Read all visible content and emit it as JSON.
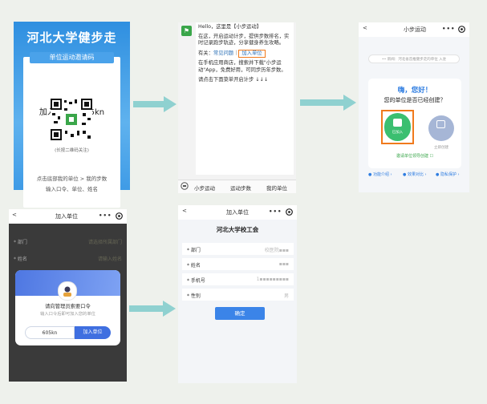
{
  "colors": {
    "arrow": "#8fd1d0",
    "brand_blue": "#2f8fe0",
    "highlight": "#f07a1c",
    "green": "#3bbf70",
    "primary": "#3f6fe0"
  },
  "poster": {
    "title": "河北大学健步走",
    "ribbon": "单位运动邀请码",
    "code_line": "加入口令：605kn",
    "qr_caption": "(长按二维码关注)",
    "hint1": "点击底部我的单位 > 我的步数",
    "hint2": "输入口令、单位、姓名"
  },
  "chat": {
    "avatar_icon": "walker-icon",
    "p1": "Hello，这里是【小步运动】",
    "p2": "在这，开启运动计步，提供步数排名，实时记录跑步轨迹，分享健身养生攻略。",
    "p3_prefix": "有关：",
    "p3_link": "常见问题",
    "p3_sep": "｜",
    "p3_highlight": "加入单位",
    "p4": "在手机应用商店，搜索并下载\"小步运动\"App，免费好用，可同步历年步数。",
    "p5": "请点击下面菜单开启计步 ↓↓↓",
    "menu": {
      "keyboard_icon": "keyboard-icon",
      "item1": "小步运动",
      "item2": "运动步数",
      "item3": "我的单位"
    }
  },
  "home": {
    "back": "<",
    "title": "小步运动",
    "more": "•••",
    "target_icon": "target-icon",
    "search": "•• 新闻：河北省首推健步走的单位 入驻",
    "hello": "嗨，您好！",
    "question": "您的单位是否已经创建？",
    "join_label": "已加入",
    "create_label": "立即创建",
    "link": "邀请单位领导创建 ☐",
    "foot": [
      "● 功能介绍 ›",
      "● 效果对比 ›",
      "● 隐私保护 ›"
    ]
  },
  "join": {
    "back": "<",
    "title": "加入单位",
    "more": "•••",
    "row1": "* 部门",
    "row1_val": "请选择所属部门",
    "row2": "* 姓名",
    "row2_val": "请输入姓名",
    "dialog_title": "请向管理员索要口令",
    "dialog_sub": "输入口令后即可加入您的单位",
    "input": "605kn",
    "button": "加入单位"
  },
  "form": {
    "back": "<",
    "title": "加入单位",
    "more": "•••",
    "org": "河北大学校工会",
    "rows": [
      {
        "label": "* 部门",
        "value": "校医院▪▪▪"
      },
      {
        "label": "* 姓名",
        "value": "▪▪▪"
      },
      {
        "label": "* 手机号",
        "value": "1▪▪▪▪▪▪▪▪▪"
      },
      {
        "label": "* 性别",
        "value": "男"
      }
    ],
    "submit": "确定"
  }
}
